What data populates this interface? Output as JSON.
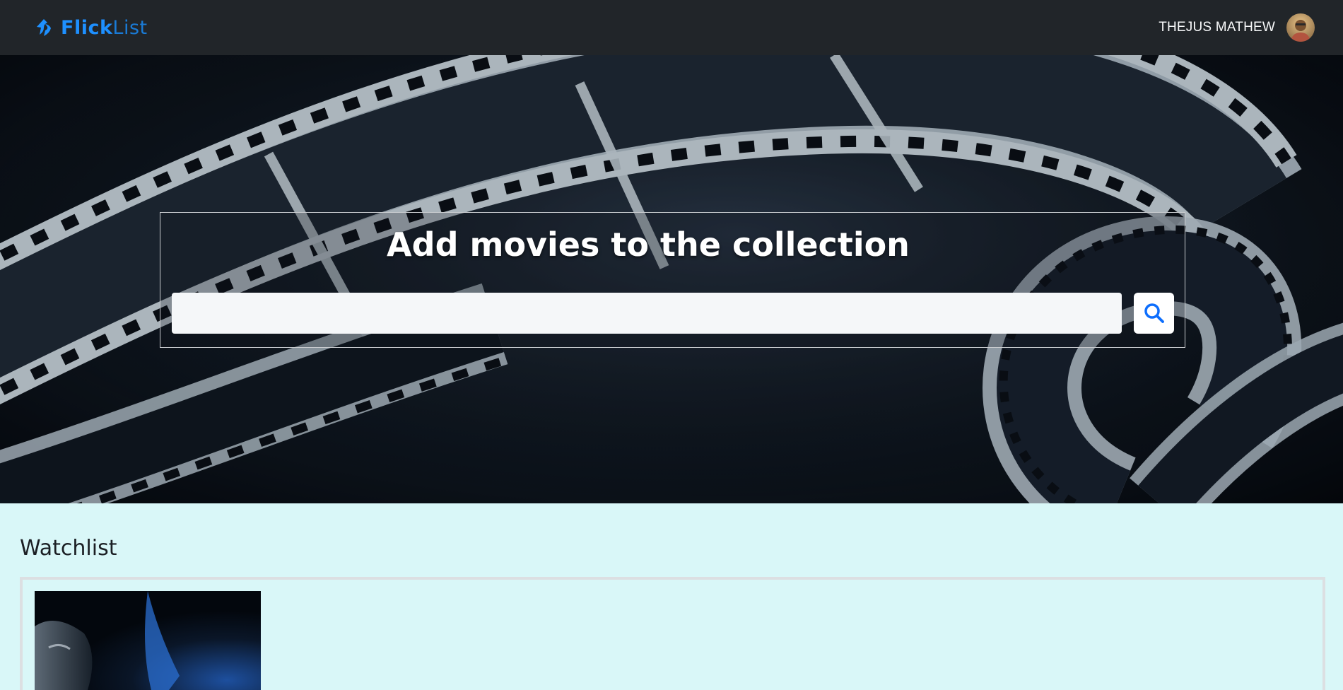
{
  "navbar": {
    "brand": {
      "part1": "Flick",
      "part2": "List",
      "icon": "brand-logo-icon"
    },
    "user": {
      "name": "THEJUS MATHEW",
      "avatar_icon": "user-avatar"
    }
  },
  "hero": {
    "title": "Add movies to the collection",
    "search": {
      "value": "",
      "placeholder": "",
      "button_icon": "search-icon"
    }
  },
  "watchlist": {
    "heading": "Watchlist",
    "items": [
      {
        "poster": "movie-poster"
      }
    ]
  },
  "colors": {
    "navbar_bg": "#212529",
    "brand_blue": "#1e90ff",
    "page_bg": "#d9f7f8",
    "search_icon": "#0d6efd"
  }
}
